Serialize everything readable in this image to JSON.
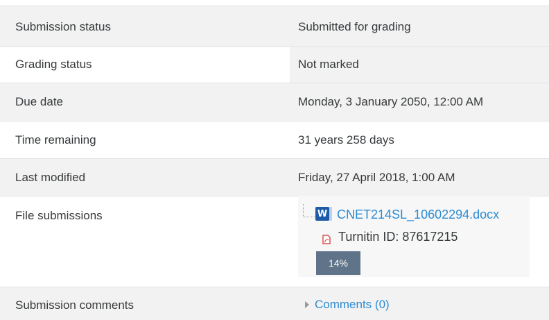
{
  "rows": [
    {
      "label": "Submission status",
      "value": "Submitted for grading"
    },
    {
      "label": "Grading status",
      "value": "Not marked"
    },
    {
      "label": "Due date",
      "value": "Monday, 3 January 2050, 12:00 AM"
    },
    {
      "label": "Time remaining",
      "value": "31 years 258 days"
    },
    {
      "label": "Last modified",
      "value": "Friday, 27 April 2018, 1:00 AM"
    },
    {
      "label": "File submissions"
    },
    {
      "label": "Submission comments"
    }
  ],
  "file": {
    "name": "CNET214SL_10602294.docx",
    "turnitin_id": "Turnitin ID: 87617215",
    "similarity": "14%",
    "icon": "word-document-icon"
  },
  "comments": {
    "label": "Comments (0)",
    "icon": "triangle-right-icon"
  },
  "colors": {
    "shade": "#f2f2f2",
    "link": "#2d8bd1",
    "badge": "#5f7389",
    "border": "#dee2e6"
  }
}
